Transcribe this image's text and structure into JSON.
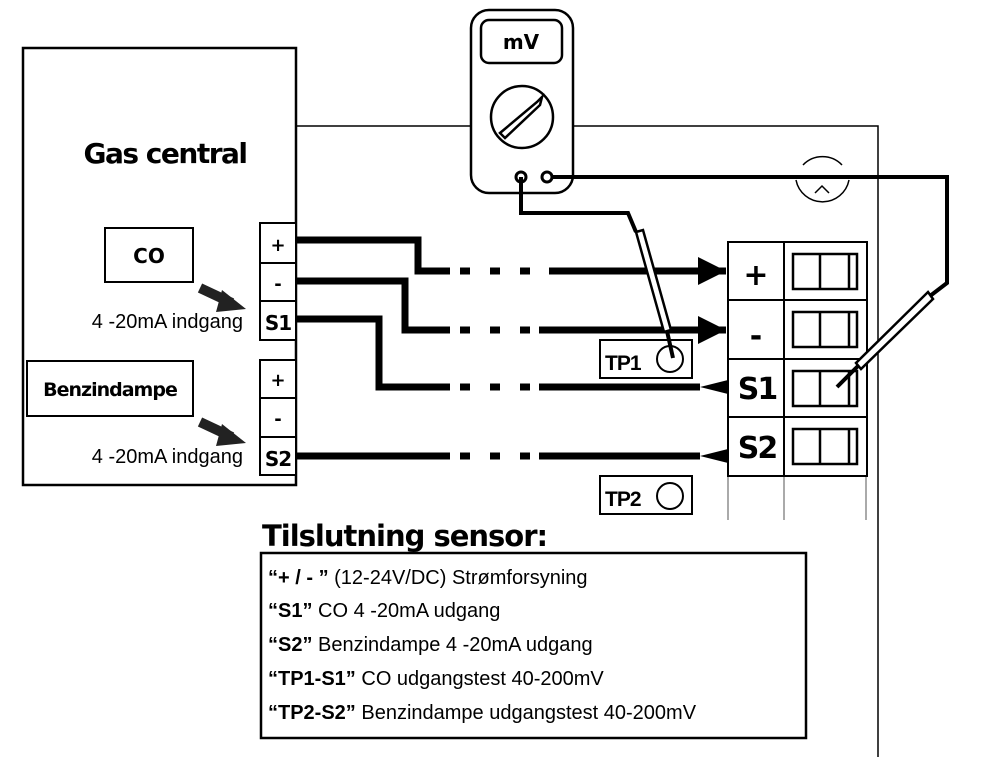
{
  "gas_central": {
    "title": "Gas central",
    "co_label": "CO",
    "benzin_label": "Benzindampe",
    "input_label_1": "4 -20mA indgang",
    "input_label_2": "4 -20mA indgang",
    "terminals_1": [
      "+",
      "-",
      "S1"
    ],
    "terminals_2": [
      "+",
      "-",
      "S2"
    ]
  },
  "multimeter": {
    "display": "mV"
  },
  "sensor": {
    "terminals": [
      "+",
      "-",
      "S1",
      "S2"
    ],
    "tp1": "TP1",
    "tp2": "TP2"
  },
  "legend": {
    "title": "Tilslutning sensor:",
    "rows": [
      {
        "key": "“+ / - ”",
        "text": " (12-24V/DC) Strømforsyning"
      },
      {
        "key": "“S1”",
        "text": " CO 4 -20mA udgang"
      },
      {
        "key": "“S2”",
        "text": " Benzindampe 4 -20mA udgang"
      },
      {
        "key": "“TP1-S1”",
        "text": " CO udgangstest 40-200mV"
      },
      {
        "key": "“TP2-S2”",
        "text": " Benzindampe udgangstest 40-200mV"
      }
    ]
  }
}
